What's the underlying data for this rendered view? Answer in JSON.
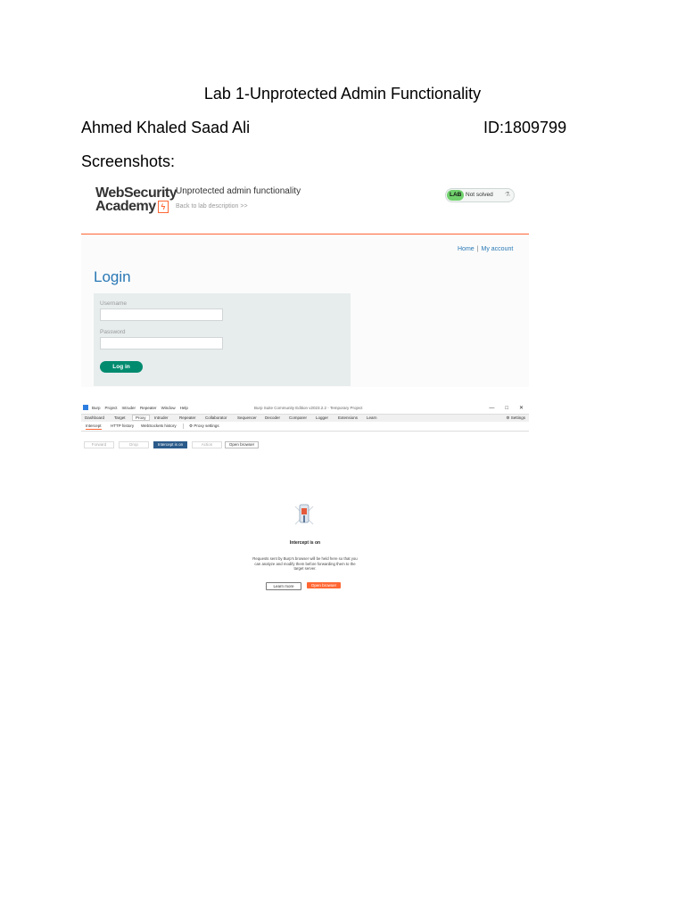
{
  "document": {
    "title": "Lab 1-Unprotected Admin Functionality",
    "author": "Ahmed Khaled Saad Ali",
    "student_id": "ID:1809799",
    "screenshots_label": "Screenshots:"
  },
  "screenshot1": {
    "logo_line1": "WebSecurity",
    "logo_line2": "Academy",
    "lab_title": "Unprotected admin functionality",
    "back_link": "Back to lab description  >>",
    "badge_label": "LAB",
    "badge_status": "Not solved",
    "nav": {
      "home": "Home",
      "separator": "|",
      "account": "My account"
    },
    "login_heading": "Login",
    "username_label": "Username",
    "password_label": "Password",
    "login_button": "Log in",
    "colors": {
      "accent": "#ff6633",
      "link": "#2978b5",
      "button": "#008b6f",
      "badge": "#70d16d"
    }
  },
  "screenshot2": {
    "menu": [
      "Burp",
      "Project",
      "Intruder",
      "Repeater",
      "Window",
      "Help"
    ],
    "window_title": "Burp Suite Community Edition v2023.2.2 - Temporary Project",
    "window_controls": [
      "—",
      "□",
      "✕"
    ],
    "tabs": [
      "Dashboard",
      "Target",
      "Proxy",
      "Intruder",
      "Repeater",
      "Collaborator",
      "Sequencer",
      "Decoder",
      "Comparer",
      "Logger",
      "Extensions",
      "Learn"
    ],
    "active_tab": "Proxy",
    "settings_label": "Settings",
    "subtabs": [
      "Intercept",
      "HTTP history",
      "WebSockets history"
    ],
    "proxy_settings": "Proxy settings",
    "toolbar": {
      "forward": "Forward",
      "drop": "Drop",
      "intercept": "Intercept is on",
      "action": "Action",
      "open_browser": "Open browser"
    },
    "status_heading": "Intercept is on",
    "description": "Requests sent by Burp's browser will be held here so that you can analyze and modify them before forwarding them to the target server.",
    "learn_more": "Learn more",
    "open_browser_button": "Open browser"
  }
}
